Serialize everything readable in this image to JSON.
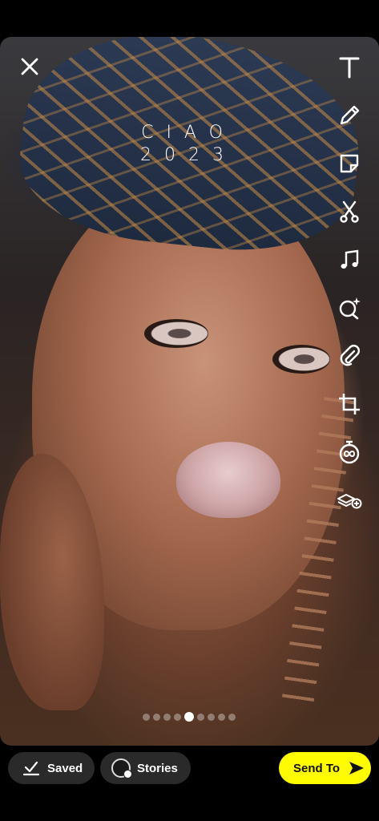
{
  "snap": {
    "caption_line1": "CIAO",
    "caption_line2": "2023"
  },
  "toolbar": {
    "icons": [
      "text-icon",
      "pencil-icon",
      "sticker-icon",
      "scissors-icon",
      "music-icon",
      "lens-icon",
      "attachment-icon",
      "crop-icon",
      "timer-icon",
      "layers-add-icon"
    ]
  },
  "pagination": {
    "total": 9,
    "active_index": 4
  },
  "bottom_bar": {
    "saved_label": "Saved",
    "stories_label": "Stories",
    "send_label": "Send To"
  },
  "colors": {
    "send_button": "#fffc00",
    "pill_background": "#2a2a2a"
  }
}
